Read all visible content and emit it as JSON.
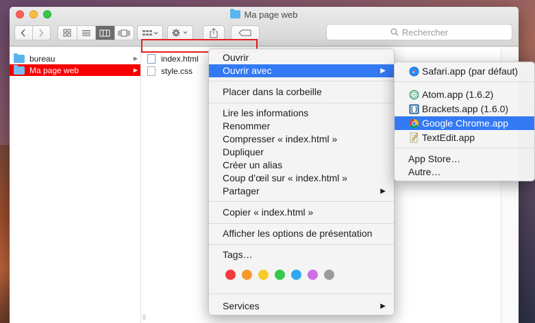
{
  "window": {
    "title": "Ma page web"
  },
  "toolbar": {
    "search_placeholder": "Rechercher",
    "view_buttons": [
      "icon-view",
      "list-view",
      "column-view",
      "coverflow-view"
    ]
  },
  "sidebar_column": {
    "items": [
      {
        "label": "bureau",
        "selected": false
      },
      {
        "label": "Ma page web",
        "selected": true
      }
    ]
  },
  "file_column": {
    "items": [
      {
        "label": "index.html",
        "selected": true
      },
      {
        "label": "style.css",
        "selected": false
      }
    ]
  },
  "context_menu": {
    "open": "Ouvrir",
    "open_with": "Ouvrir avec",
    "trash": "Placer dans la corbeille",
    "get_info": "Lire les informations",
    "rename": "Renommer",
    "compress": "Compresser « index.html »",
    "duplicate": "Dupliquer",
    "alias": "Créer un alias",
    "quicklook": "Coup d’œil sur « index.html »",
    "share": "Partager",
    "copy": "Copier « index.html »",
    "view_options": "Afficher les options de présentation",
    "tags": "Tags…",
    "services": "Services",
    "tag_colors": [
      "#f53a3a",
      "#f79a2c",
      "#f7cc2a",
      "#35c84a",
      "#2fa8f0",
      "#cf6ee6",
      "#9b9b9b"
    ]
  },
  "open_with_menu": {
    "safari": "Safari.app (par défaut)",
    "atom": "Atom.app (1.6.2)",
    "brackets": "Brackets.app (1.6.0)",
    "chrome": "Google Chrome.app",
    "textedit": "TextEdit.app",
    "appstore": "App Store…",
    "other": "Autre…"
  },
  "colors": {
    "accent": "#3379f3",
    "selection": "#f70000"
  }
}
